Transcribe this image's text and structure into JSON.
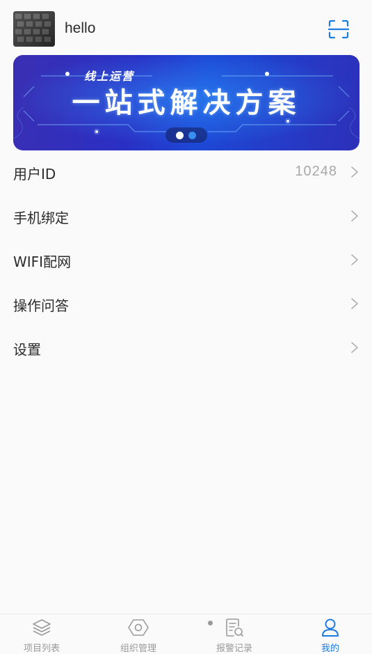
{
  "header": {
    "username": "hello",
    "avatar_icon": "keyboard-photo",
    "scan_icon": "scan-icon"
  },
  "banner": {
    "subtitle": "线上运营",
    "title": "一站式解决方案",
    "pager": {
      "total": 2,
      "active": 1
    }
  },
  "menu": {
    "items": [
      {
        "label": "用户ID",
        "value": "10248"
      },
      {
        "label": "手机绑定",
        "value": ""
      },
      {
        "label": "WIFI配网",
        "value": ""
      },
      {
        "label": "操作问答",
        "value": ""
      },
      {
        "label": "设置",
        "value": ""
      }
    ]
  },
  "tabbar": {
    "tabs": [
      {
        "label": "项目列表",
        "icon": "layers-icon",
        "active": false
      },
      {
        "label": "组织管理",
        "icon": "hexagon-icon",
        "active": false
      },
      {
        "label": "报警记录",
        "icon": "report-icon",
        "active": false
      },
      {
        "label": "我的",
        "icon": "user-icon",
        "active": true
      }
    ]
  },
  "colors": {
    "accent": "#1e7be0",
    "text": "#2b2b2b",
    "muted": "#9a9a9a",
    "banner_start": "#3a2fb3",
    "banner_end": "#1c48d6"
  }
}
